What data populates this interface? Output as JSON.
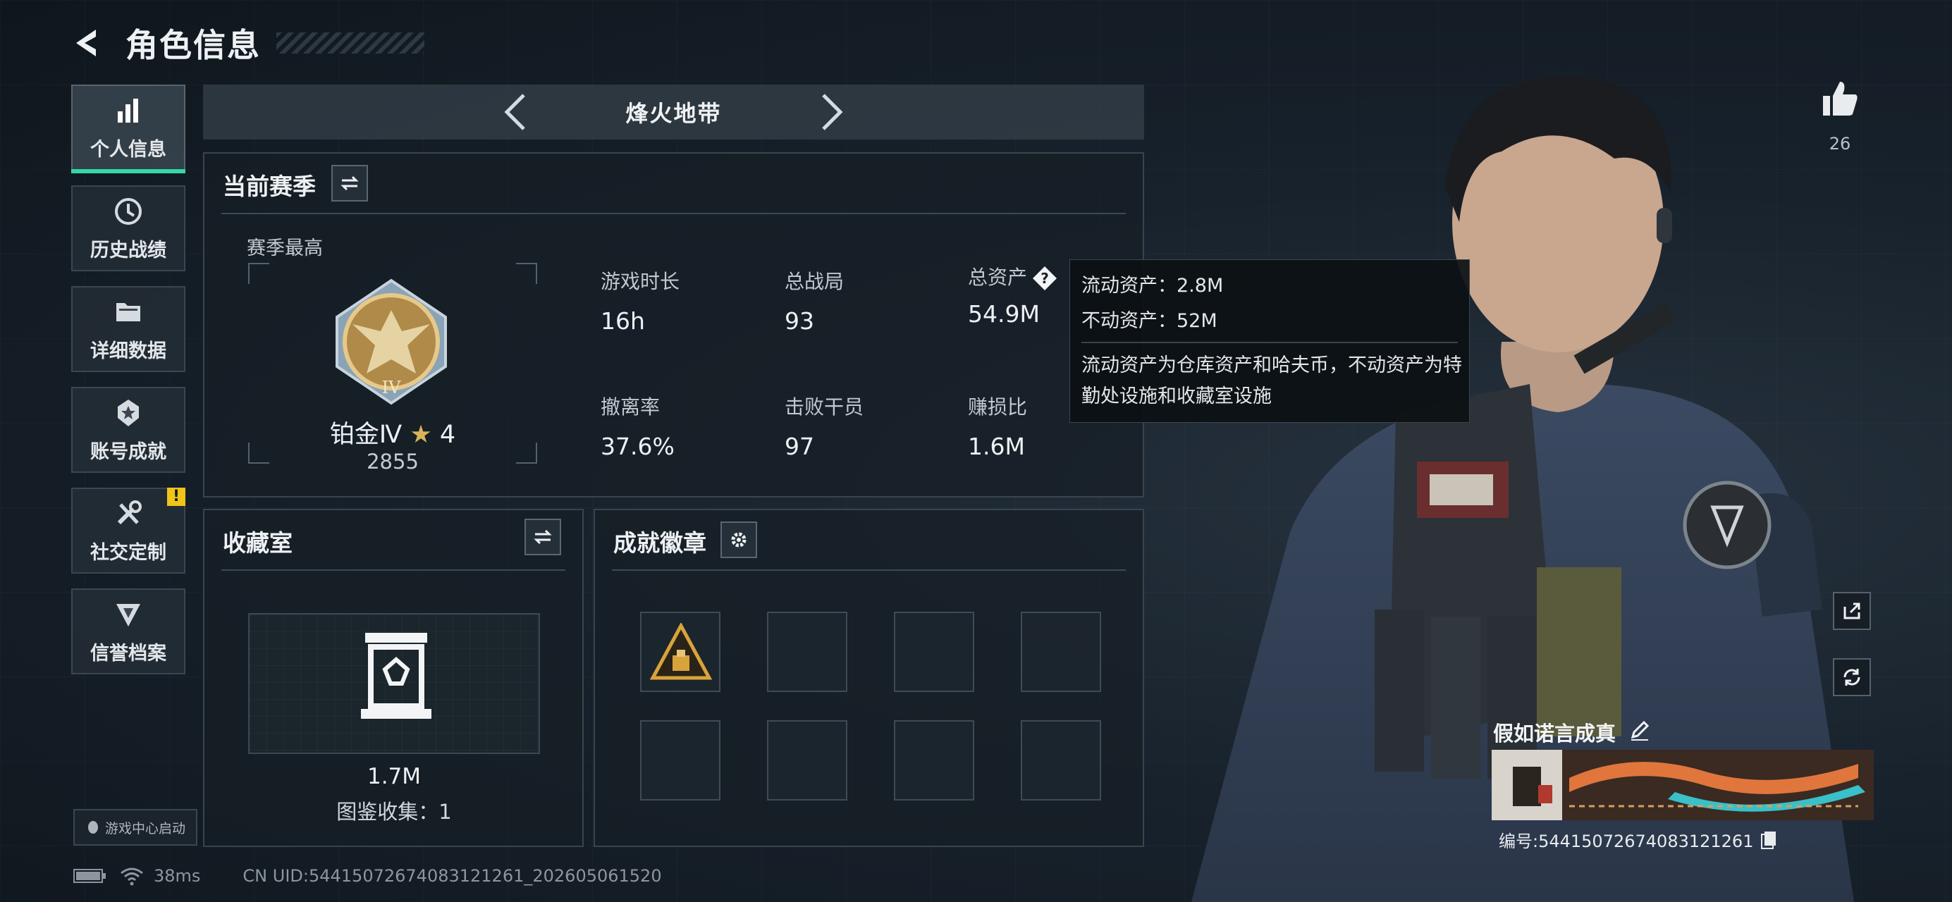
{
  "header": {
    "title": "角色信息"
  },
  "sidebar": {
    "items": [
      {
        "label": "个人信息",
        "icon": "bar-chart-icon",
        "active": true
      },
      {
        "label": "历史战绩",
        "icon": "history-clock-icon"
      },
      {
        "label": "详细数据",
        "icon": "folder-icon"
      },
      {
        "label": "账号成就",
        "icon": "achievement-medal-icon"
      },
      {
        "label": "社交定制",
        "icon": "tools-icon",
        "badge": "!"
      },
      {
        "label": "信誉档案",
        "icon": "shield-emblem-icon"
      }
    ],
    "game_center_label": "游戏中心启动"
  },
  "mode_bar": {
    "name": "烽火地带"
  },
  "season": {
    "title": "当前赛季",
    "best_label": "赛季最高",
    "rank_name": "铂金Ⅳ",
    "rank_stars": "4",
    "rank_score": "2855",
    "badge_numeral": "IV",
    "stats": [
      {
        "label": "游戏时长",
        "value": "16h"
      },
      {
        "label": "总战局",
        "value": "93"
      },
      {
        "label": "总资产",
        "value": "54.9M"
      },
      {
        "label": "撤离率",
        "value": "37.6%"
      },
      {
        "label": "击败干员",
        "value": "97"
      },
      {
        "label": "赚损比",
        "value": "1.6M"
      }
    ]
  },
  "tooltip": {
    "liquid": "流动资产：2.8M",
    "fixed": "不动资产：52M",
    "description": "流动资产为仓库资产和哈夫币，不动资产为特勤处设施和收藏室设施"
  },
  "collection": {
    "title": "收藏室",
    "value": "1.7M",
    "count": "图鉴收集：1"
  },
  "achievements": {
    "title": "成就徽章",
    "slot_count": 8
  },
  "profile": {
    "likes": "26",
    "player_name": "假如诺言成真",
    "player_id": "编号:54415072674083121261"
  },
  "status_bar": {
    "ping": "38ms",
    "uid": "CN UID:54415072674083121261_202605061520"
  },
  "colors": {
    "accent": "#35d6a8",
    "rank_gold": "#d9b25b",
    "warning": "#f0c419"
  }
}
